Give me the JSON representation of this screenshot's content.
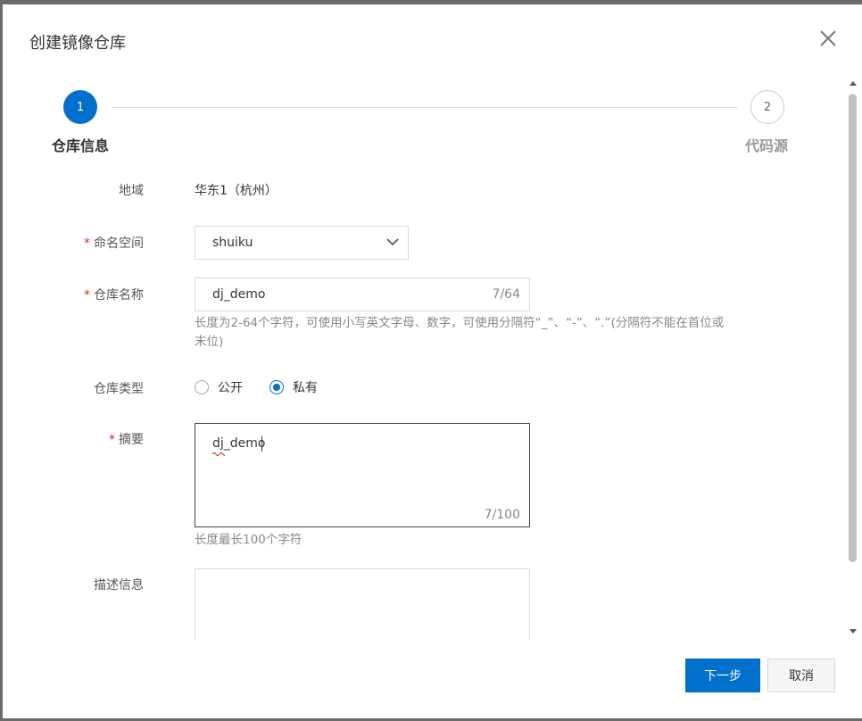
{
  "dialog": {
    "title": "创建镜像仓库"
  },
  "steps": [
    {
      "number": "1",
      "label": "仓库信息",
      "active": true
    },
    {
      "number": "2",
      "label": "代码源",
      "active": false
    }
  ],
  "form": {
    "region": {
      "label": "地域",
      "value": "华东1（杭州）"
    },
    "namespace": {
      "label": "命名空间",
      "required": "*",
      "value": "shuiku"
    },
    "repo_name": {
      "label": "仓库名称",
      "required": "*",
      "value": "dj_demo",
      "count": "7/64",
      "hint_line1": "长度为2-64个字符，可使用小写英文字母、数字，可使用分隔符“_”、“-”、“.”(分隔符不能在首位或",
      "hint_line2": "末位)"
    },
    "repo_type": {
      "label": "仓库类型",
      "options": [
        {
          "label": "公开",
          "checked": false
        },
        {
          "label": "私有",
          "checked": true
        }
      ]
    },
    "summary": {
      "label": "摘要",
      "required": "*",
      "value": "dj_demo",
      "count": "7/100",
      "hint": "长度最长100个字符"
    },
    "description": {
      "label": "描述信息",
      "value": ""
    }
  },
  "footer": {
    "next_label": "下一步",
    "cancel_label": "取消"
  },
  "colors": {
    "primary": "#0070cc",
    "required": "#e2231a",
    "overlay": "#6b6b6b"
  }
}
